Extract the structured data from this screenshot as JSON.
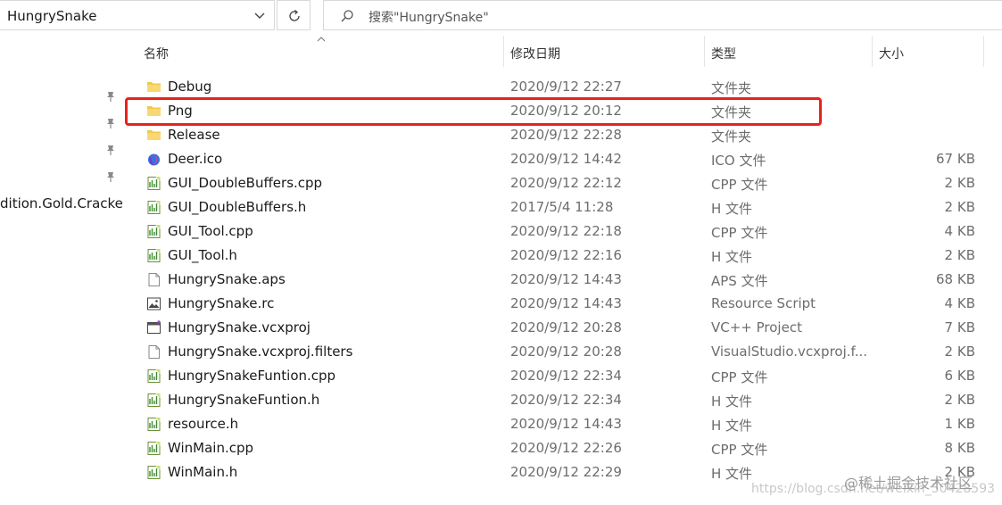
{
  "address": {
    "title": "HungrySnake"
  },
  "search": {
    "placeholder": "搜索\"HungrySnake\""
  },
  "nav": {
    "partial_label": "dition.Gold.Cracked"
  },
  "columns": {
    "name": "名称",
    "date": "修改日期",
    "type": "类型",
    "size": "大小"
  },
  "files": [
    {
      "name": "Debug",
      "date": "2020/9/12 22:27",
      "type": "文件夹",
      "size": "",
      "icon": "folder-icon"
    },
    {
      "name": "Png",
      "date": "2020/9/12 20:12",
      "type": "文件夹",
      "size": "",
      "icon": "folder-icon"
    },
    {
      "name": "Release",
      "date": "2020/9/12 22:28",
      "type": "文件夹",
      "size": "",
      "icon": "folder-icon"
    },
    {
      "name": "Deer.ico",
      "date": "2020/9/12 14:42",
      "type": "ICO 文件",
      "size": "67 KB",
      "icon": "ico-file-icon"
    },
    {
      "name": "GUI_DoubleBuffers.cpp",
      "date": "2020/9/12 22:12",
      "type": "CPP 文件",
      "size": "2 KB",
      "icon": "source-file-icon"
    },
    {
      "name": "GUI_DoubleBuffers.h",
      "date": "2017/5/4 11:28",
      "type": "H 文件",
      "size": "2 KB",
      "icon": "source-file-icon"
    },
    {
      "name": "GUI_Tool.cpp",
      "date": "2020/9/12 22:18",
      "type": "CPP 文件",
      "size": "4 KB",
      "icon": "source-file-icon"
    },
    {
      "name": "GUI_Tool.h",
      "date": "2020/9/12 22:16",
      "type": "H 文件",
      "size": "2 KB",
      "icon": "source-file-icon"
    },
    {
      "name": "HungrySnake.aps",
      "date": "2020/9/12 14:43",
      "type": "APS 文件",
      "size": "68 KB",
      "icon": "blank-file-icon"
    },
    {
      "name": "HungrySnake.rc",
      "date": "2020/9/12 14:43",
      "type": "Resource Script",
      "size": "4 KB",
      "icon": "resource-file-icon"
    },
    {
      "name": "HungrySnake.vcxproj",
      "date": "2020/9/12 20:28",
      "type": "VC++ Project",
      "size": "7 KB",
      "icon": "project-file-icon"
    },
    {
      "name": "HungrySnake.vcxproj.filters",
      "date": "2020/9/12 20:28",
      "type": "VisualStudio.vcxproj.f...",
      "size": "2 KB",
      "icon": "blank-file-icon"
    },
    {
      "name": "HungrySnakeFuntion.cpp",
      "date": "2020/9/12 22:34",
      "type": "CPP 文件",
      "size": "6 KB",
      "icon": "source-file-icon"
    },
    {
      "name": "HungrySnakeFuntion.h",
      "date": "2020/9/12 22:34",
      "type": "H 文件",
      "size": "2 KB",
      "icon": "source-file-icon"
    },
    {
      "name": "resource.h",
      "date": "2020/9/12 14:43",
      "type": "H 文件",
      "size": "1 KB",
      "icon": "source-file-icon"
    },
    {
      "name": "WinMain.cpp",
      "date": "2020/9/12 22:26",
      "type": "CPP 文件",
      "size": "8 KB",
      "icon": "source-file-icon"
    },
    {
      "name": "WinMain.h",
      "date": "2020/9/12 22:29",
      "type": "H 文件",
      "size": "2 KB",
      "icon": "source-file-icon"
    }
  ],
  "watermark": {
    "brand": "@稀土掘金技术社区",
    "url": "https://blog.csdn.net/weixin_50428593"
  },
  "colors": {
    "highlight": "#e8221b",
    "folder": "#f2c84b",
    "text_secondary": "#6d6d6d"
  }
}
